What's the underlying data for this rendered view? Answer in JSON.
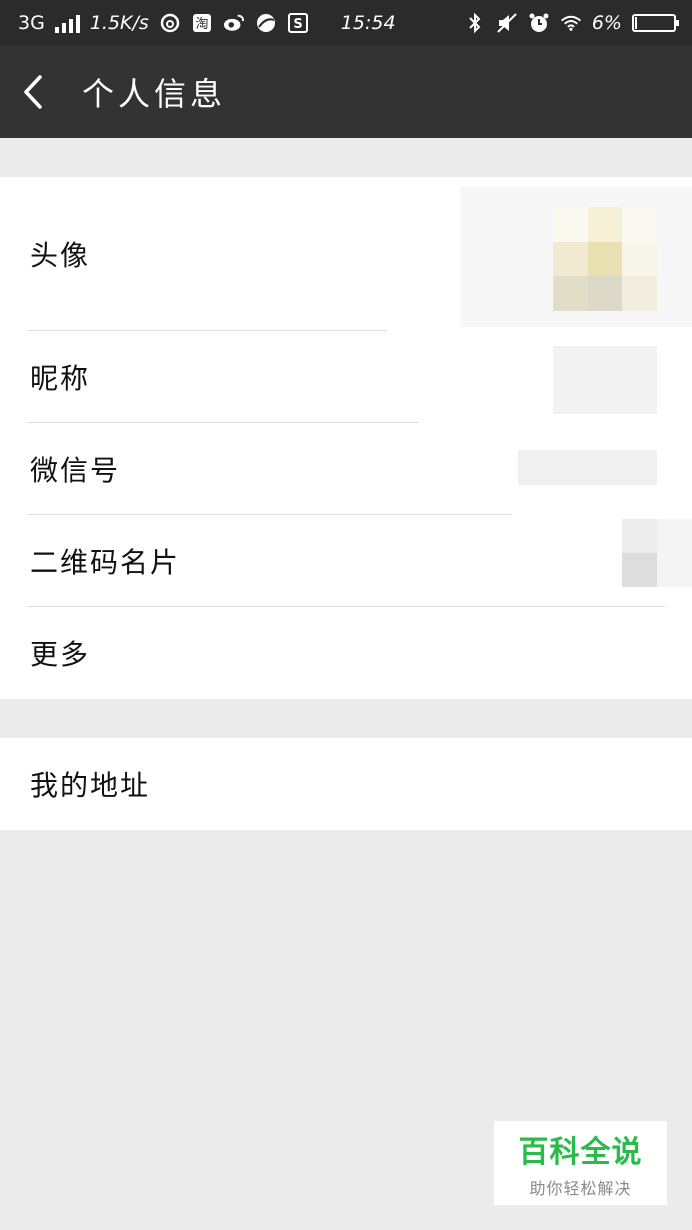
{
  "status_bar": {
    "network": "3G",
    "speed": "1.5K/s",
    "time": "15:54",
    "battery": "6%",
    "battery_level": 0.06,
    "left_icons": [
      "netease-music-icon",
      "taobao-icon",
      "weibo-icon",
      "browser-icon",
      "s-app-icon"
    ],
    "right_icons": [
      "bluetooth-icon",
      "mute-icon",
      "alarm-icon",
      "wifi-icon"
    ]
  },
  "header": {
    "title": "个人信息"
  },
  "profile": {
    "items": [
      {
        "label": "头像"
      },
      {
        "label": "昵称"
      },
      {
        "label": "微信号"
      },
      {
        "label": "二维码名片"
      },
      {
        "label": "更多"
      }
    ]
  },
  "address": {
    "label": "我的地址"
  },
  "watermark": {
    "main": "百科全说",
    "sub": "助你轻松解决"
  },
  "colors": {
    "header_bg": "#333333",
    "status_bg": "#2b2b2b",
    "page_bg": "#ebebeb",
    "watermark_green": "#2cbb4a"
  }
}
